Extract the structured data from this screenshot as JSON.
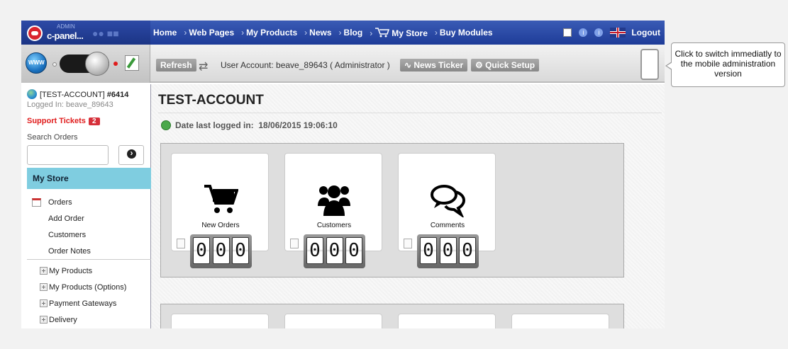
{
  "logo": {
    "admin": "ADMIN",
    "text": "c-panel..."
  },
  "nav": {
    "home": "Home",
    "web_pages": "Web Pages",
    "my_products": "My Products",
    "news": "News",
    "blog": "Blog",
    "my_store": "My Store",
    "buy_modules": "Buy Modules",
    "arrow": "›",
    "logout": "Logout"
  },
  "toolbar": {
    "refresh": "Refresh",
    "user_account": "User Account: beave_89643 ( Administrator )",
    "news_ticker": "News Ticker",
    "quick_setup": "Quick Setup"
  },
  "sidebar": {
    "account": "[TEST-ACCOUNT]",
    "account_id": "#6414",
    "logged_in": "Logged In: beave_89643",
    "support_tickets": "Support Tickets",
    "support_count": "2",
    "search_label": "Search Orders",
    "section": "My Store",
    "items": [
      {
        "label": "Orders"
      },
      {
        "label": "Add Order"
      },
      {
        "label": "Customers"
      },
      {
        "label": "Order Notes"
      },
      {
        "label": "My Products"
      },
      {
        "label": "My Products (Options)"
      },
      {
        "label": "Payment Gateways"
      },
      {
        "label": "Delivery"
      }
    ]
  },
  "main": {
    "title": "TEST-ACCOUNT",
    "date_label": "Date last logged in:",
    "date_value": "18/06/2015 19:06:10",
    "cards": [
      {
        "label": "New Orders",
        "icon": "cart-icon",
        "digits": [
          "0",
          "0",
          "0"
        ]
      },
      {
        "label": "Customers",
        "icon": "users-icon",
        "digits": [
          "0",
          "0",
          "0"
        ]
      },
      {
        "label": "Comments",
        "icon": "comments-icon",
        "digits": [
          "0",
          "0",
          "0"
        ]
      }
    ]
  },
  "callout": {
    "text": "Click to switch immediatly to the mobile administration version"
  },
  "colors": {
    "nav_bg": "#1e3c98",
    "section_bg": "#7fcde0",
    "support_red": "#e01c1c"
  }
}
